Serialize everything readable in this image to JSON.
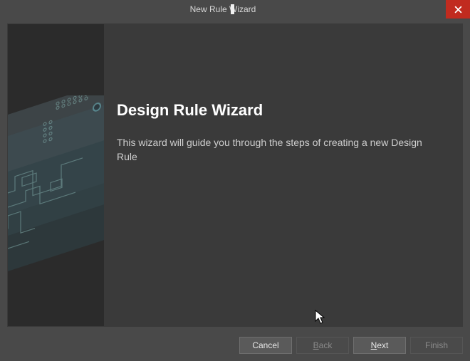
{
  "titlebar": {
    "title": "New Rule Wizard"
  },
  "main": {
    "heading": "Design Rule Wizard",
    "description": "This wizard will guide you through the steps of creating a new Design Rule"
  },
  "buttons": {
    "cancel": "Cancel",
    "back_prefix": "B",
    "back_rest": "ack",
    "next_prefix": "N",
    "next_rest": "ext",
    "finish": "Finish"
  }
}
